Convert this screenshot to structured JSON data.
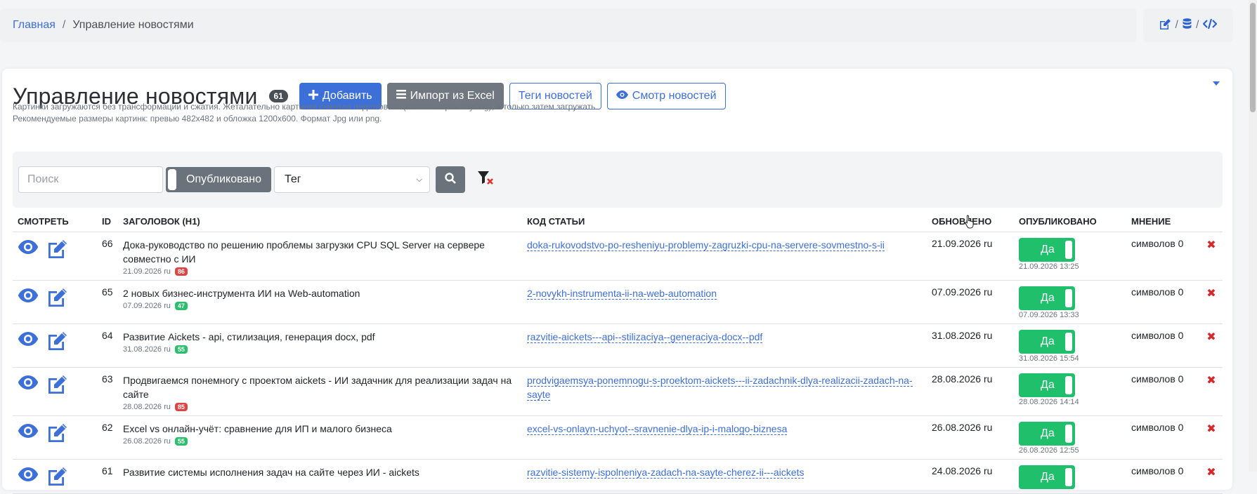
{
  "breadcrumb": {
    "home": "Главная",
    "separator": "/",
    "current": "Управление новостями"
  },
  "tools": {
    "separator": "/",
    "icons": [
      "edit-icon",
      "database-icon",
      "code-icon"
    ]
  },
  "header": {
    "title": "Управление новостями",
    "count": "61",
    "buttons": {
      "add": "Добавить",
      "import": "Импорт из Excel",
      "tags": "Теги новостей",
      "view": "Смотр новостей"
    }
  },
  "notes": {
    "line1": "Картинки загружаются без трансформации и сжатия. Жеталательно картинки сначала подготовить (сжатие через tinyPng), и только затем загружать.",
    "line2": "Рекомендуемые размеры картинк: превью 482x482 и обложка 1200x600. Формат Jpg или png."
  },
  "filters": {
    "search_placeholder": "Поиск",
    "published_toggle": "Опубликовано",
    "tag_select": "Тег"
  },
  "table": {
    "headers": [
      "СМОТРЕТЬ",
      "ID",
      "ЗАГОЛОВОК (H1)",
      "КОД СТАТЬИ",
      "ОБНОВЛЕНО",
      "ОПУБЛИКОВАНО",
      "МНЕНИЕ"
    ],
    "rows": [
      {
        "id": "66",
        "title": "Дока-руководство по решению проблемы загрузки CPU SQL Server на сервере совместно с ИИ",
        "date": "21.09.2026 ru",
        "score": "86",
        "score_color": "#e04545",
        "code": "doka-rukovodstvo-po-resheniyu-problemy-zagruzki-cpu-na-servere-sovmestno-s-ii",
        "updated": "21.09.2026 ru",
        "pub_label": "Да",
        "pub_date": "21.09.2026 13:25",
        "opinion": "символов 0"
      },
      {
        "id": "65",
        "title": "2 новых бизнес-инструмента ИИ на Web-automation",
        "date": "07.09.2026 ru",
        "score": "47",
        "score_color": "#2bbf6b",
        "code": "2-novykh-instrumenta-ii-na-web-automation",
        "updated": "07.09.2026 ru",
        "pub_label": "Да",
        "pub_date": "07.09.2026 13:33",
        "opinion": "символов 0"
      },
      {
        "id": "64",
        "title": "Развитие Aickets - api, стилизация, генерация docx, pdf",
        "date": "31.08.2026 ru",
        "score": "55",
        "score_color": "#2bbf6b",
        "code": "razvitie-aickets---api--stilizaciya--generaciya-docx--pdf",
        "updated": "31.08.2026 ru",
        "pub_label": "Да",
        "pub_date": "31.08.2026 15:54",
        "opinion": "символов 0"
      },
      {
        "id": "63",
        "title": "Продвигаемся понемногу с проектом aickets - ИИ задачник для реализации задач на сайте",
        "date": "28.08.2026 ru",
        "score": "85",
        "score_color": "#e04545",
        "code": "prodvigaemsya-ponemnogu-s-proektom-aickets---ii-zadachnik-dlya-realizacii-zadach-na-sayte",
        "updated": "28.08.2026 ru",
        "pub_label": "Да",
        "pub_date": "28.08.2026 14:14",
        "opinion": "символов 0"
      },
      {
        "id": "62",
        "title": "Excel vs онлайн-учёт: сравнение для ИП и малого бизнеса",
        "date": "26.08.2026 ru",
        "score": "55",
        "score_color": "#2bbf6b",
        "code": "excel-vs-onlayn-uchyot--sravnenie-dlya-ip-i-malogo-biznesa",
        "updated": "26.08.2026 ru",
        "pub_label": "Да",
        "pub_date": "26.08.2026 12:55",
        "opinion": "символов 0"
      },
      {
        "id": "61",
        "title": "Развитие системы исполнения задач на сайте через ИИ - aickets",
        "date": "",
        "score": "",
        "score_color": "#2bbf6b",
        "code": "razvitie-sistemy-ispolneniya-zadach-na-sayte-cherez-ii---aickets",
        "updated": "24.08.2026 ru",
        "pub_label": "Да",
        "pub_date": "",
        "opinion": "символов 0"
      }
    ]
  },
  "colors": {
    "primary": "#3d6fd8",
    "secondary": "#707780",
    "success": "#1fbf6b",
    "danger": "#d62828"
  }
}
